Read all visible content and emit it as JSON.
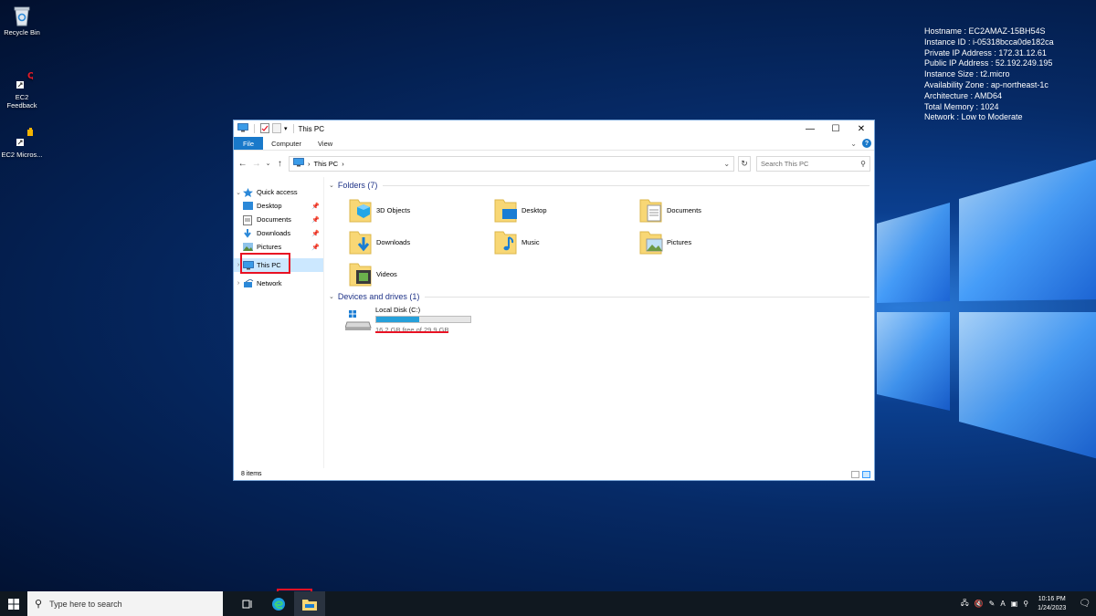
{
  "desktop": {
    "icons": [
      {
        "label": "Recycle Bin",
        "icon": "recycle-bin-icon"
      },
      {
        "label": "EC2 Feedback",
        "icon": "ec2-feedback-icon"
      },
      {
        "label": "EC2 Micros...",
        "icon": "ec2-microsoft-icon"
      }
    ],
    "sysinfo": [
      "Hostname : EC2AMAZ-15BH54S",
      "Instance ID : i-05318bcca0de182ca",
      "Private IP Address : 172.31.12.61",
      "Public IP Address : 52.192.249.195",
      "Instance Size : t2.micro",
      "Availability Zone : ap-northeast-1c",
      "Architecture : AMD64",
      "Total Memory : 1024",
      "Network : Low to Moderate"
    ]
  },
  "explorer": {
    "title": "This PC",
    "ribbon_tabs": [
      "File",
      "Computer",
      "View"
    ],
    "address": "This PC",
    "search_placeholder": "Search This PC",
    "nav": {
      "quick_access": "Quick access",
      "items": [
        "Desktop",
        "Documents",
        "Downloads",
        "Pictures"
      ],
      "this_pc": "This PC",
      "network": "Network"
    },
    "folders_header": "Folders (7)",
    "folders": [
      "3D Objects",
      "Desktop",
      "Documents",
      "Downloads",
      "Music",
      "Pictures",
      "Videos"
    ],
    "devices_header": "Devices and drives (1)",
    "drive": {
      "name": "Local Disk (C:)",
      "free_text": "16.2 GB free of 29.9 GB",
      "used_fraction": 0.46
    },
    "status": "8 items"
  },
  "taskbar": {
    "search_placeholder": "Type here to search",
    "time": "10:16 PM",
    "date": "1/24/2023",
    "ime": "A"
  },
  "colors": {
    "accent": "#1979ca",
    "highlight": "#e81123",
    "selected": "#cce8ff"
  }
}
